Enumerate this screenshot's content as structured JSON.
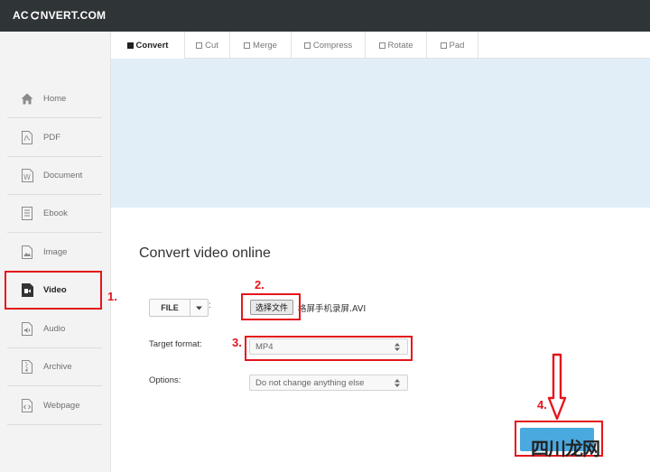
{
  "app": {
    "logo_left": "AC",
    "logo_right": "NVERT.COM"
  },
  "sidebar": {
    "items": [
      {
        "label": "Home",
        "icon": "home-icon"
      },
      {
        "label": "PDF",
        "icon": "pdf-file-icon"
      },
      {
        "label": "Document",
        "icon": "word-document-icon"
      },
      {
        "label": "Ebook",
        "icon": "ebook-icon"
      },
      {
        "label": "Image",
        "icon": "image-icon"
      },
      {
        "label": "Video",
        "icon": "video-icon",
        "active": true
      },
      {
        "label": "Audio",
        "icon": "audio-icon"
      },
      {
        "label": "Archive",
        "icon": "archive-icon"
      },
      {
        "label": "Webpage",
        "icon": "webpage-icon"
      }
    ]
  },
  "tabs": [
    {
      "label": "Convert",
      "active": true
    },
    {
      "label": "Cut"
    },
    {
      "label": "Merge"
    },
    {
      "label": "Compress"
    },
    {
      "label": "Rotate"
    },
    {
      "label": "Pad"
    }
  ],
  "main": {
    "heading": "Convert video online",
    "file_button": "FILE",
    "colon": ":",
    "choose_file_button": "选择文件",
    "file_name": "格屏手机录屏.AVI",
    "target_format_label": "Target format:",
    "target_format_value": "MP4",
    "options_label": "Options:",
    "options_value": "Do not change anything else"
  },
  "annotations": {
    "step1": "1.",
    "step2": "2.",
    "step3": "3.",
    "step4": "4."
  },
  "watermark": "四川龙网",
  "colors": {
    "topbar": "#2f3437",
    "accent_blue": "#4aa9de",
    "banner": "#e1eef8",
    "annotation_red": "#e4161b"
  }
}
